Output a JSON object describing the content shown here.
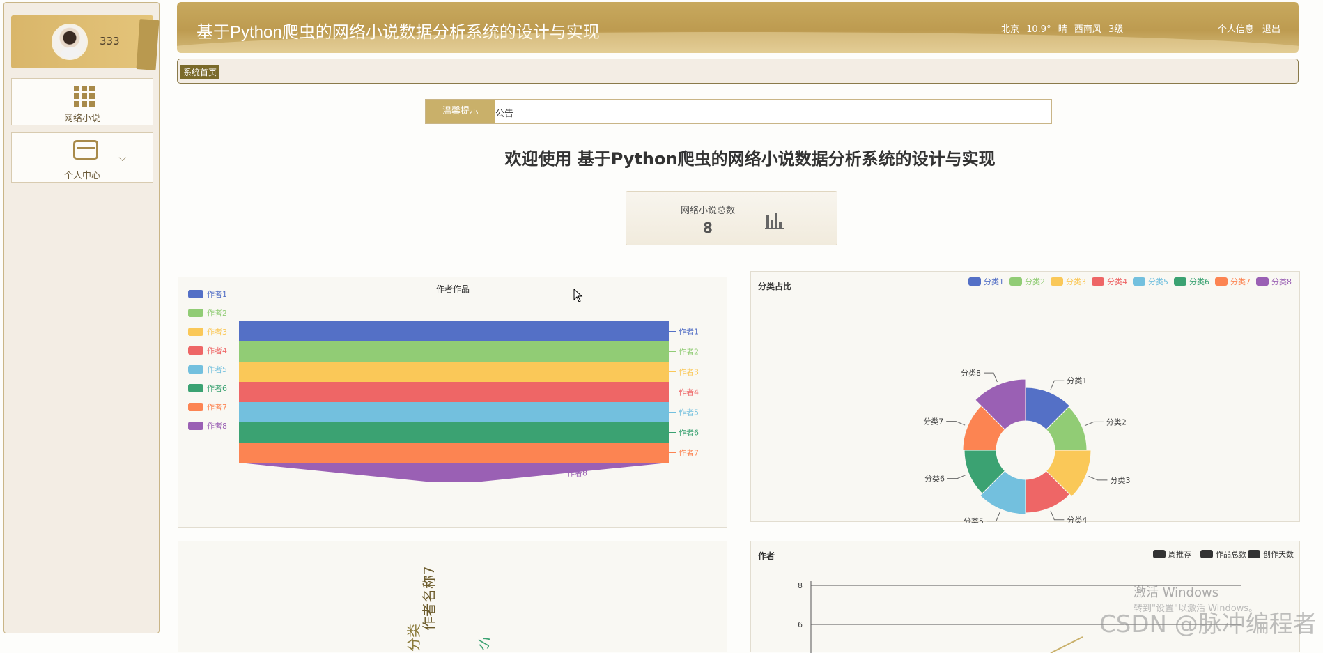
{
  "user": {
    "name": "333"
  },
  "sidebar": {
    "items": [
      {
        "label": "网络小说",
        "icon": "grid-icon"
      },
      {
        "label": "个人中心",
        "icon": "card-icon"
      }
    ]
  },
  "header": {
    "title": "基于Python爬虫的网络小说数据分析系统的设计与实现",
    "weather": "北京  10.9°  晴  西南风  3级",
    "links": [
      "个人信息",
      "退出"
    ]
  },
  "breadcrumb": "系统首页",
  "notice": {
    "tag": "温馨提示",
    "text": "公告"
  },
  "welcome": "欢迎使用 基于Python爬虫的网络小说数据分析系统的设计与实现",
  "stat": {
    "label": "网络小说总数",
    "value": "8"
  },
  "colors": [
    "#5470c6",
    "#91cc75",
    "#fac858",
    "#ee6666",
    "#73c0de",
    "#3ba272",
    "#fc8452",
    "#9a60b4"
  ],
  "chart_data": [
    {
      "type": "funnel",
      "title": "作者作品",
      "categories": [
        "作者1",
        "作者2",
        "作者3",
        "作者4",
        "作者5",
        "作者6",
        "作者7",
        "作者8"
      ],
      "legend": "left"
    },
    {
      "type": "pie",
      "title": "分类占比",
      "categories": [
        "分类1",
        "分类2",
        "分类3",
        "分类4",
        "分类5",
        "分类6",
        "分类7",
        "分类8"
      ],
      "values": [
        1,
        1,
        1,
        1,
        1,
        1,
        1,
        1
      ],
      "donut": true,
      "legend": "top-right"
    },
    {
      "type": "wordcloud",
      "visible_words": [
        "作者名称7",
        "分类",
        "小"
      ]
    },
    {
      "type": "line",
      "title": "作者",
      "legend_items": [
        "周推荐",
        "作品总数",
        "创作天数"
      ],
      "y_ticks": [
        "8",
        "6"
      ]
    }
  ],
  "watermark": {
    "line1": "激活 Windows",
    "line2": "转到\"设置\"以激活 Windows。",
    "csdn": "CSDN @脉冲编程者"
  }
}
